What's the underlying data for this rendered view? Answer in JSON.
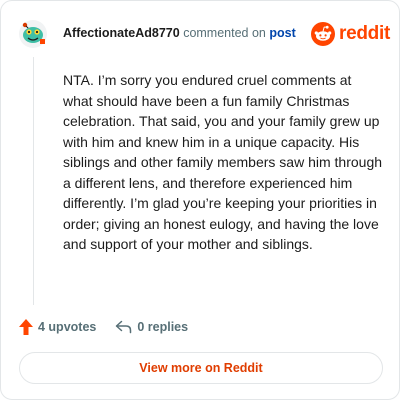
{
  "comment": {
    "username": "AffectionateAd8770",
    "commented_text": "commented on",
    "post_link_label": "post",
    "body": "NTA. I’m sorry you endured cruel comments at what should have been a fun family Christmas celebration. That said, you and your family grew up with him and knew him in a unique capacity. His siblings and other family members saw him through a different lens, and therefore experienced him differently. I’m glad you’re keeping your priorities in order; giving an honest eulogy, and having the love and support of your mother and siblings."
  },
  "brand": {
    "wordmark": "reddit",
    "color": "#ff4500"
  },
  "actions": {
    "upvotes_label": "4 upvotes",
    "replies_label": "0 replies"
  },
  "footer": {
    "view_more_label": "View more on Reddit"
  },
  "icons": {
    "avatar": "snoo-avatar-icon",
    "logo": "reddit-snoo-icon",
    "upvote": "upvote-arrow-icon",
    "reply": "reply-arrow-icon"
  }
}
